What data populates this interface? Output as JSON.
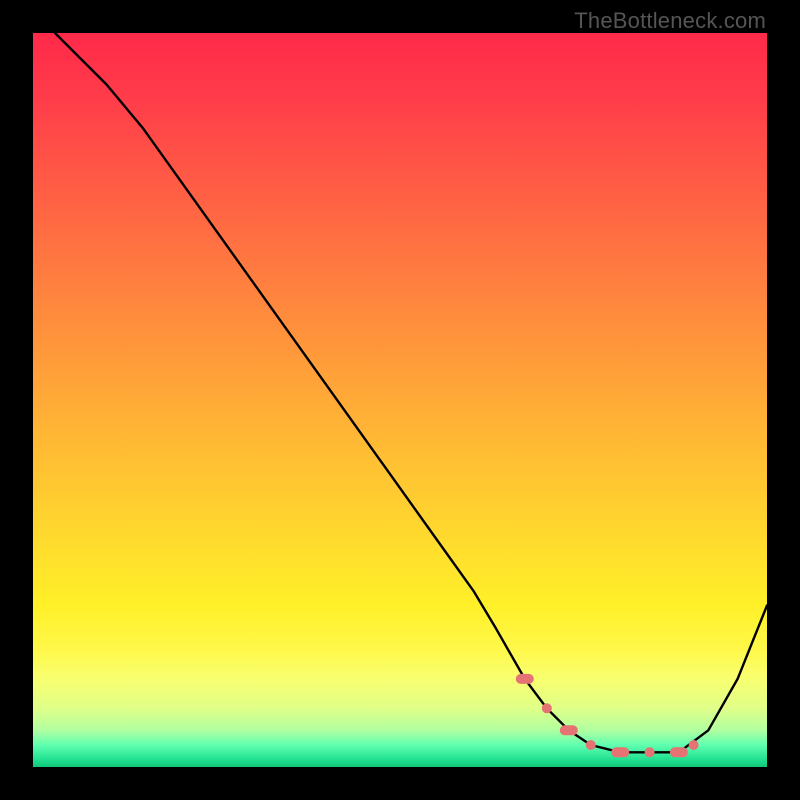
{
  "attribution": "TheBottleneck.com",
  "chart_data": {
    "type": "line",
    "title": "",
    "xlabel": "",
    "ylabel": "",
    "xlim": [
      0,
      100
    ],
    "ylim": [
      0,
      100
    ],
    "curve": {
      "name": "bottleneck-curve",
      "x": [
        3,
        6,
        10,
        15,
        20,
        25,
        30,
        35,
        40,
        45,
        50,
        55,
        60,
        63,
        67,
        70,
        73,
        76,
        80,
        84,
        88,
        92,
        96,
        100
      ],
      "y": [
        100,
        97,
        93,
        87,
        80,
        73,
        66,
        59,
        52,
        45,
        38,
        31,
        24,
        19,
        12,
        8,
        5,
        3,
        2,
        2,
        2,
        5,
        12,
        22
      ]
    },
    "highlight_band": {
      "name": "optimal-range-markers",
      "color": "#e57373",
      "x": [
        67,
        70,
        73,
        76,
        80,
        84,
        88,
        90
      ],
      "y": [
        12,
        8,
        5,
        3,
        2,
        2,
        2,
        3
      ]
    },
    "gradient_stops": [
      {
        "pos": 0.0,
        "color": "#ff2a4a"
      },
      {
        "pos": 0.5,
        "color": "#ffba34"
      },
      {
        "pos": 0.82,
        "color": "#fff84a"
      },
      {
        "pos": 0.96,
        "color": "#60ffb0"
      },
      {
        "pos": 1.0,
        "color": "#10c878"
      }
    ]
  }
}
